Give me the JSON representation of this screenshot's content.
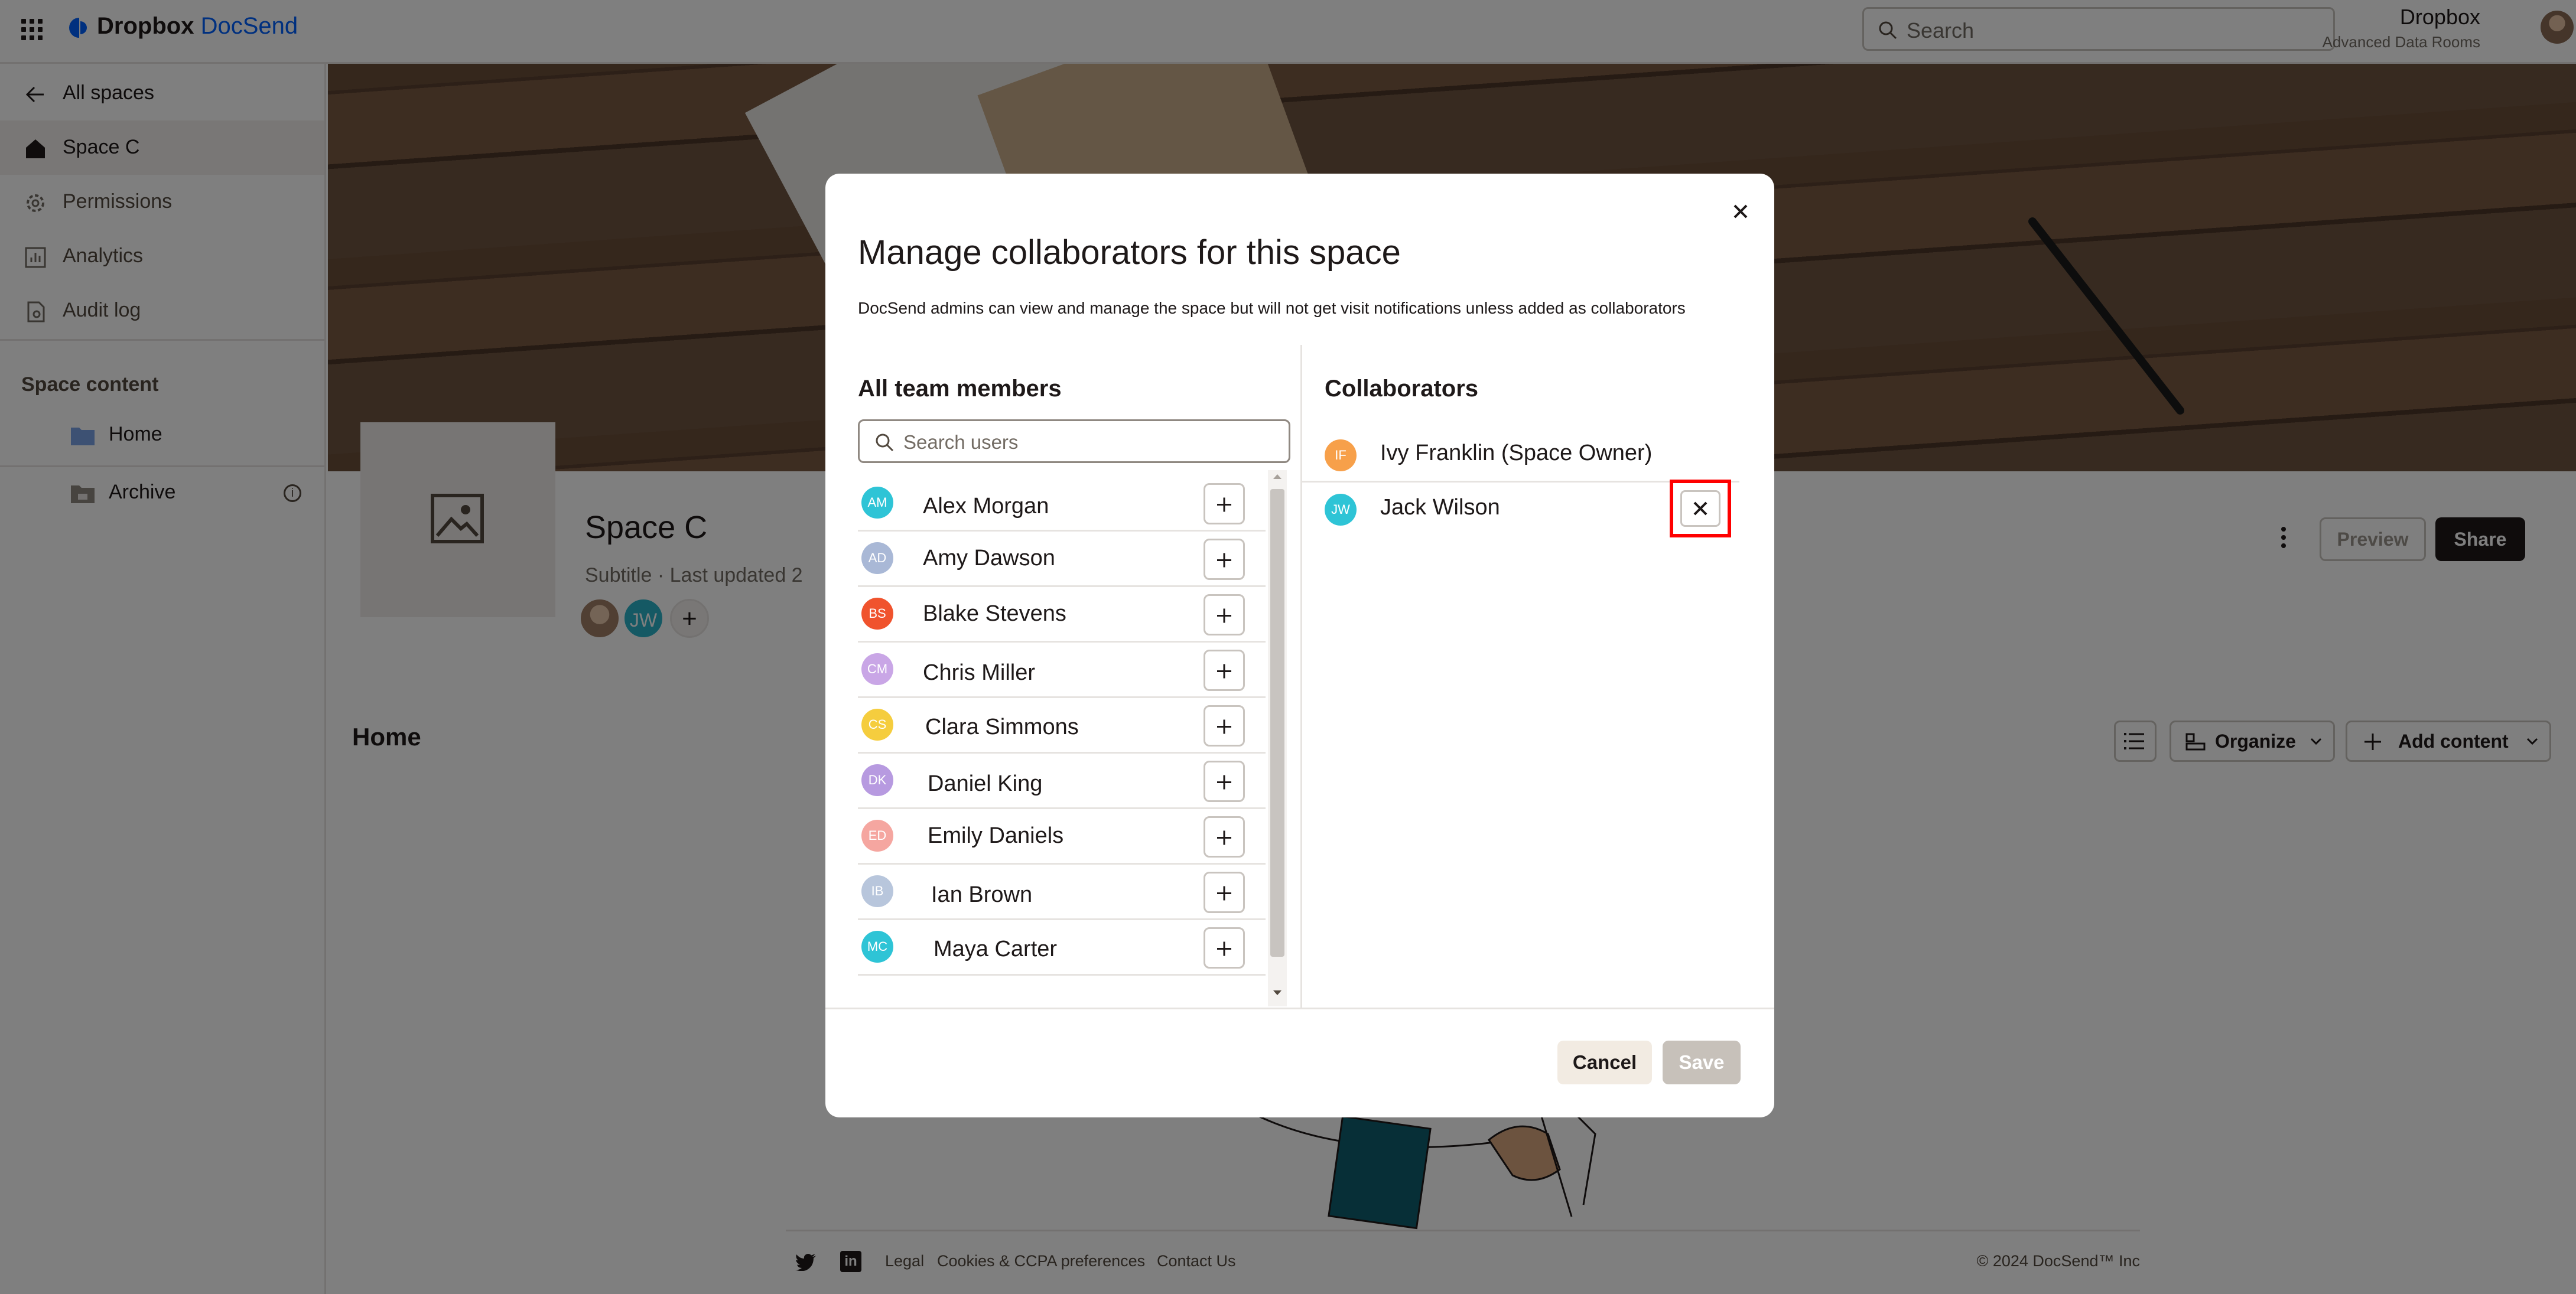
{
  "header": {
    "brand": "Dropbox",
    "product": "DocSend",
    "search_placeholder": "Search",
    "account_name": "Dropbox",
    "account_plan": "Advanced Data Rooms"
  },
  "sidebar": {
    "back_label": "All spaces",
    "items": [
      {
        "label": "Space C",
        "icon": "home-icon",
        "active": true
      },
      {
        "label": "Permissions",
        "icon": "gear-icon"
      },
      {
        "label": "Analytics",
        "icon": "chart-icon"
      },
      {
        "label": "Audit log",
        "icon": "document-icon"
      }
    ],
    "content_heading": "Space content",
    "folders": [
      {
        "label": "Home",
        "icon": "folder-icon"
      },
      {
        "label": "Archive",
        "icon": "archive-icon"
      }
    ],
    "info_glyph": "i"
  },
  "space": {
    "title": "Space C",
    "subtitle": "Subtitle  ·  Last updated 2",
    "avatar_initials": "JW",
    "add_glyph": "+",
    "preview_label": "Preview",
    "share_label": "Share",
    "section_title": "Home",
    "organize_label": "Organize",
    "add_content_label": "Add content"
  },
  "footer": {
    "legal": "Legal",
    "cookies": "Cookies & CCPA preferences",
    "contact": "Contact Us",
    "copyright": "© 2024 DocSend™ Inc",
    "linkedin_glyph": "in"
  },
  "modal": {
    "title": "Manage collaborators for this space",
    "description": "DocSend admins can view and manage the space but will not get visit notifications unless added as collaborators",
    "members_heading": "All team members",
    "search_placeholder": "Search users",
    "members": [
      {
        "initials": "AM",
        "name": "Alex Morgan",
        "color": "#2ec4d6"
      },
      {
        "initials": "AD",
        "name": "Amy Dawson",
        "color": "#a9b8d6"
      },
      {
        "initials": "BS",
        "name": "Blake Stevens",
        "color": "#f0532d"
      },
      {
        "initials": "CM",
        "name": "Chris Miller",
        "color": "#c9a6e6"
      },
      {
        "initials": "CS",
        "name": "Clara Simmons",
        "color": "#f5cd3e"
      },
      {
        "initials": "DK",
        "name": "Daniel King",
        "color": "#b79ae0"
      },
      {
        "initials": "ED",
        "name": "Emily Daniels",
        "color": "#f5a6a0"
      },
      {
        "initials": "IB",
        "name": "Ian Brown",
        "color": "#b8c6dc"
      },
      {
        "initials": "MC",
        "name": "Maya Carter",
        "color": "#2ec4d6"
      }
    ],
    "collaborators_heading": "Collaborators",
    "collaborators": [
      {
        "initials": "IF",
        "name": "Ivy Franklin (Space Owner)",
        "color": "#f7a04a"
      },
      {
        "initials": "JW",
        "name": "Jack Wilson",
        "color": "#2ec4d6"
      }
    ],
    "cancel_label": "Cancel",
    "save_label": "Save"
  }
}
